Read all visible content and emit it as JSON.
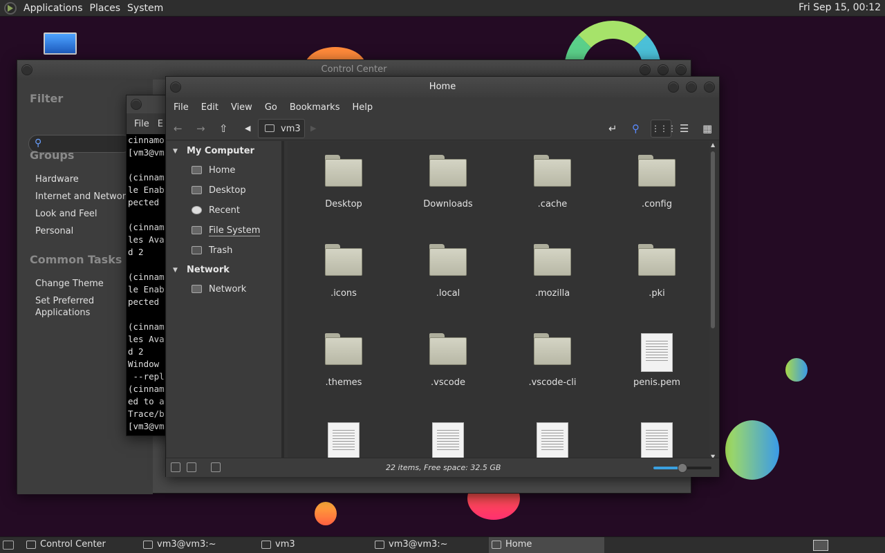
{
  "top_panel": {
    "menus": [
      "Applications",
      "Places",
      "System"
    ],
    "clock": "Fri Sep 15, 00:12"
  },
  "colors": {
    "accent": "#3aa0e0",
    "panel": "#2e2e2e",
    "window": "#3a3a3a",
    "desktop": "#240b24"
  },
  "control_center": {
    "title": "Control Center",
    "filter_label": "Filter",
    "groups_label": "Groups",
    "groups": [
      "Hardware",
      "Internet and Network",
      "Look and Feel",
      "Personal"
    ],
    "common_tasks_label": "Common Tasks",
    "tasks": [
      "Change Theme",
      "Set Preferred",
      "Applications"
    ]
  },
  "terminal": {
    "menu_file": "File",
    "menu_edit_partial": "E",
    "lines": [
      "cinnamo",
      "[vm3@vm",
      "",
      "(cinnam",
      "le Enab",
      "pected",
      "",
      "(cinnam",
      "les Ava",
      "d 2",
      "",
      "(cinnam",
      "le Enab",
      "pected",
      "",
      "(cinnam",
      "les Ava",
      "d 2",
      "Window",
      " --repl",
      "(cinnam",
      "ed to a",
      "Trace/b",
      "[vm3@vm"
    ]
  },
  "home": {
    "title": "Home",
    "menu": [
      "File",
      "Edit",
      "View",
      "Go",
      "Bookmarks",
      "Help"
    ],
    "breadcrumb": "vm3",
    "sidebar": {
      "my_computer": "My Computer",
      "items": [
        "Home",
        "Desktop",
        "Recent",
        "File System",
        "Trash"
      ],
      "network_header": "Network",
      "network_items": [
        "Network"
      ]
    },
    "items": [
      {
        "name": "Desktop",
        "type": "folder-desktop"
      },
      {
        "name": "Downloads",
        "type": "folder"
      },
      {
        "name": ".cache",
        "type": "folder"
      },
      {
        "name": ".config",
        "type": "folder"
      },
      {
        "name": ".icons",
        "type": "folder"
      },
      {
        "name": ".local",
        "type": "folder"
      },
      {
        "name": ".mozilla",
        "type": "folder"
      },
      {
        "name": ".pki",
        "type": "folder"
      },
      {
        "name": ".themes",
        "type": "folder"
      },
      {
        "name": ".vscode",
        "type": "folder"
      },
      {
        "name": ".vscode-cli",
        "type": "folder"
      },
      {
        "name": "penis.pem",
        "type": "document"
      },
      {
        "name": "",
        "type": "document"
      },
      {
        "name": "",
        "type": "document"
      },
      {
        "name": "",
        "type": "document"
      },
      {
        "name": "",
        "type": "document"
      }
    ],
    "status": "22 items, Free space: 32.5 GB",
    "zoom_level": 0.5
  },
  "taskbar": {
    "tasks": [
      "Control Center",
      "vm3@vm3:~",
      "vm3",
      "vm3@vm3:~",
      "Home"
    ],
    "active_task": "Home"
  }
}
